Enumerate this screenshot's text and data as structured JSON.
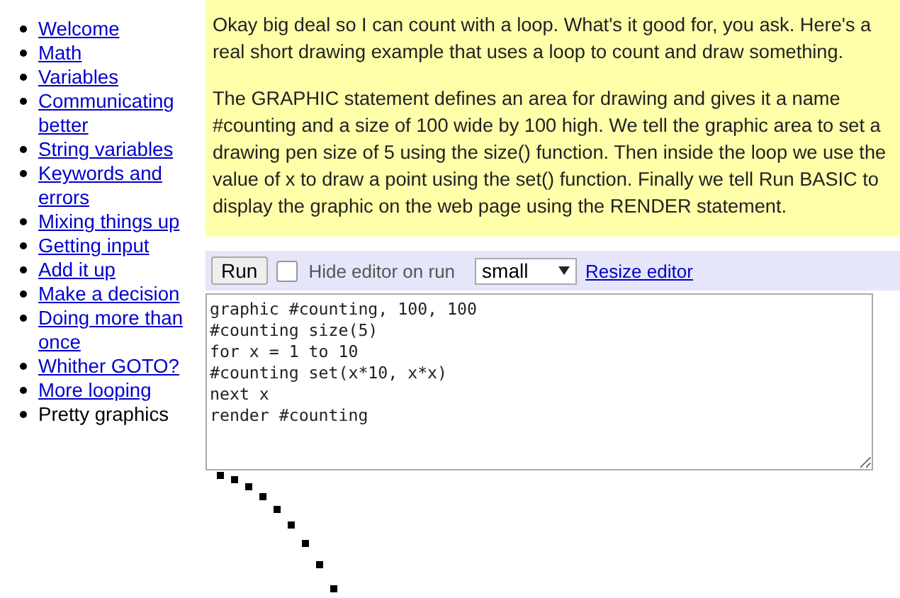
{
  "sidebar": {
    "items": [
      {
        "label": "Welcome",
        "selected": false
      },
      {
        "label": "Math",
        "selected": false
      },
      {
        "label": "Variables",
        "selected": false
      },
      {
        "label": "Communicating better",
        "selected": false
      },
      {
        "label": "String variables",
        "selected": false
      },
      {
        "label": "Keywords and errors",
        "selected": false
      },
      {
        "label": "Mixing things up",
        "selected": false
      },
      {
        "label": "Getting input",
        "selected": false
      },
      {
        "label": "Add it up",
        "selected": false
      },
      {
        "label": "Make a decision",
        "selected": false
      },
      {
        "label": "Doing more than once",
        "selected": false
      },
      {
        "label": "Whither GOTO?",
        "selected": false
      },
      {
        "label": "More looping",
        "selected": false
      },
      {
        "label": "Pretty graphics",
        "selected": true
      }
    ]
  },
  "lesson": {
    "paragraphs": [
      "Okay big deal so I can count with a loop. What's it good for, you ask. Here's a real short drawing example that uses a loop to count and draw something.",
      "The GRAPHIC statement defines an area for drawing and gives it a name #counting and a size of 100 wide by 100 high. We tell the graphic area to set a drawing pen size of 5 using the size() function. Then inside the loop we use the value of x to draw a point using the set() function. Finally we tell Run BASIC to display the graphic on the web page using the RENDER statement."
    ]
  },
  "toolbar": {
    "run_button": "Run",
    "hide_editor": {
      "label": "Hide editor on run",
      "checked": false
    },
    "size_select": "small",
    "resize_link": "Resize editor"
  },
  "editor": {
    "lines": [
      "graphic #counting, 100, 100",
      "#counting size(5)",
      "for x = 1 to 10",
      "#counting set(x*10, x*x)",
      "next x",
      "render #counting"
    ]
  }
}
